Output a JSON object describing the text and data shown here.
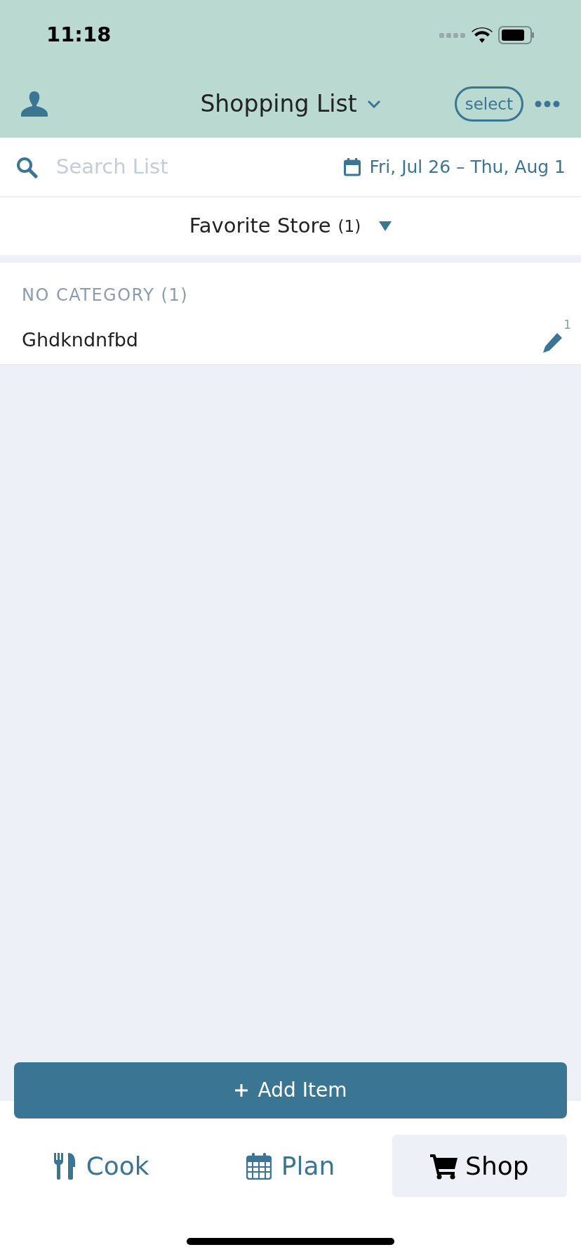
{
  "status_bar": {
    "time": "11:18"
  },
  "header": {
    "title": "Shopping List",
    "select_button": "select"
  },
  "search": {
    "placeholder": "Search List",
    "date_range": "Fri, Jul 26 – Thu, Aug 1"
  },
  "store": {
    "name": "Favorite Store",
    "count": "(1)"
  },
  "categories": [
    {
      "title": "NO CATEGORY (1)",
      "items": [
        {
          "name": "Ghdkndnfbd",
          "quantity": "1"
        }
      ]
    }
  ],
  "add_button": "Add Item",
  "tabs": [
    {
      "label": "Cook",
      "selected": false
    },
    {
      "label": "Plan",
      "selected": false
    },
    {
      "label": "Shop",
      "selected": true
    }
  ]
}
